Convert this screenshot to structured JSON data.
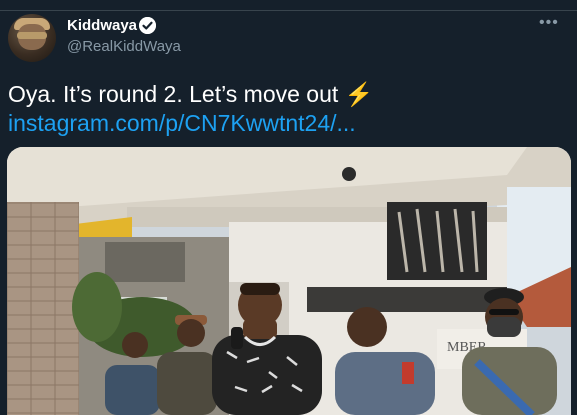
{
  "tweet": {
    "display_name": "Kiddwaya",
    "handle": "@RealKiddWaya",
    "text": "Oya. It’s round 2. Let’s move out",
    "emoji": "⚡",
    "link": "instagram.com/p/CN7Kwwtnt24/...",
    "more_icon": "more-icon",
    "verified_icon": "verified-badge-icon"
  },
  "photo": {
    "sign_text": "MBER"
  },
  "colors": {
    "background": "#15202b",
    "link": "#1da1f2",
    "secondary_text": "#8899a6",
    "verified": "#1da1f2"
  }
}
